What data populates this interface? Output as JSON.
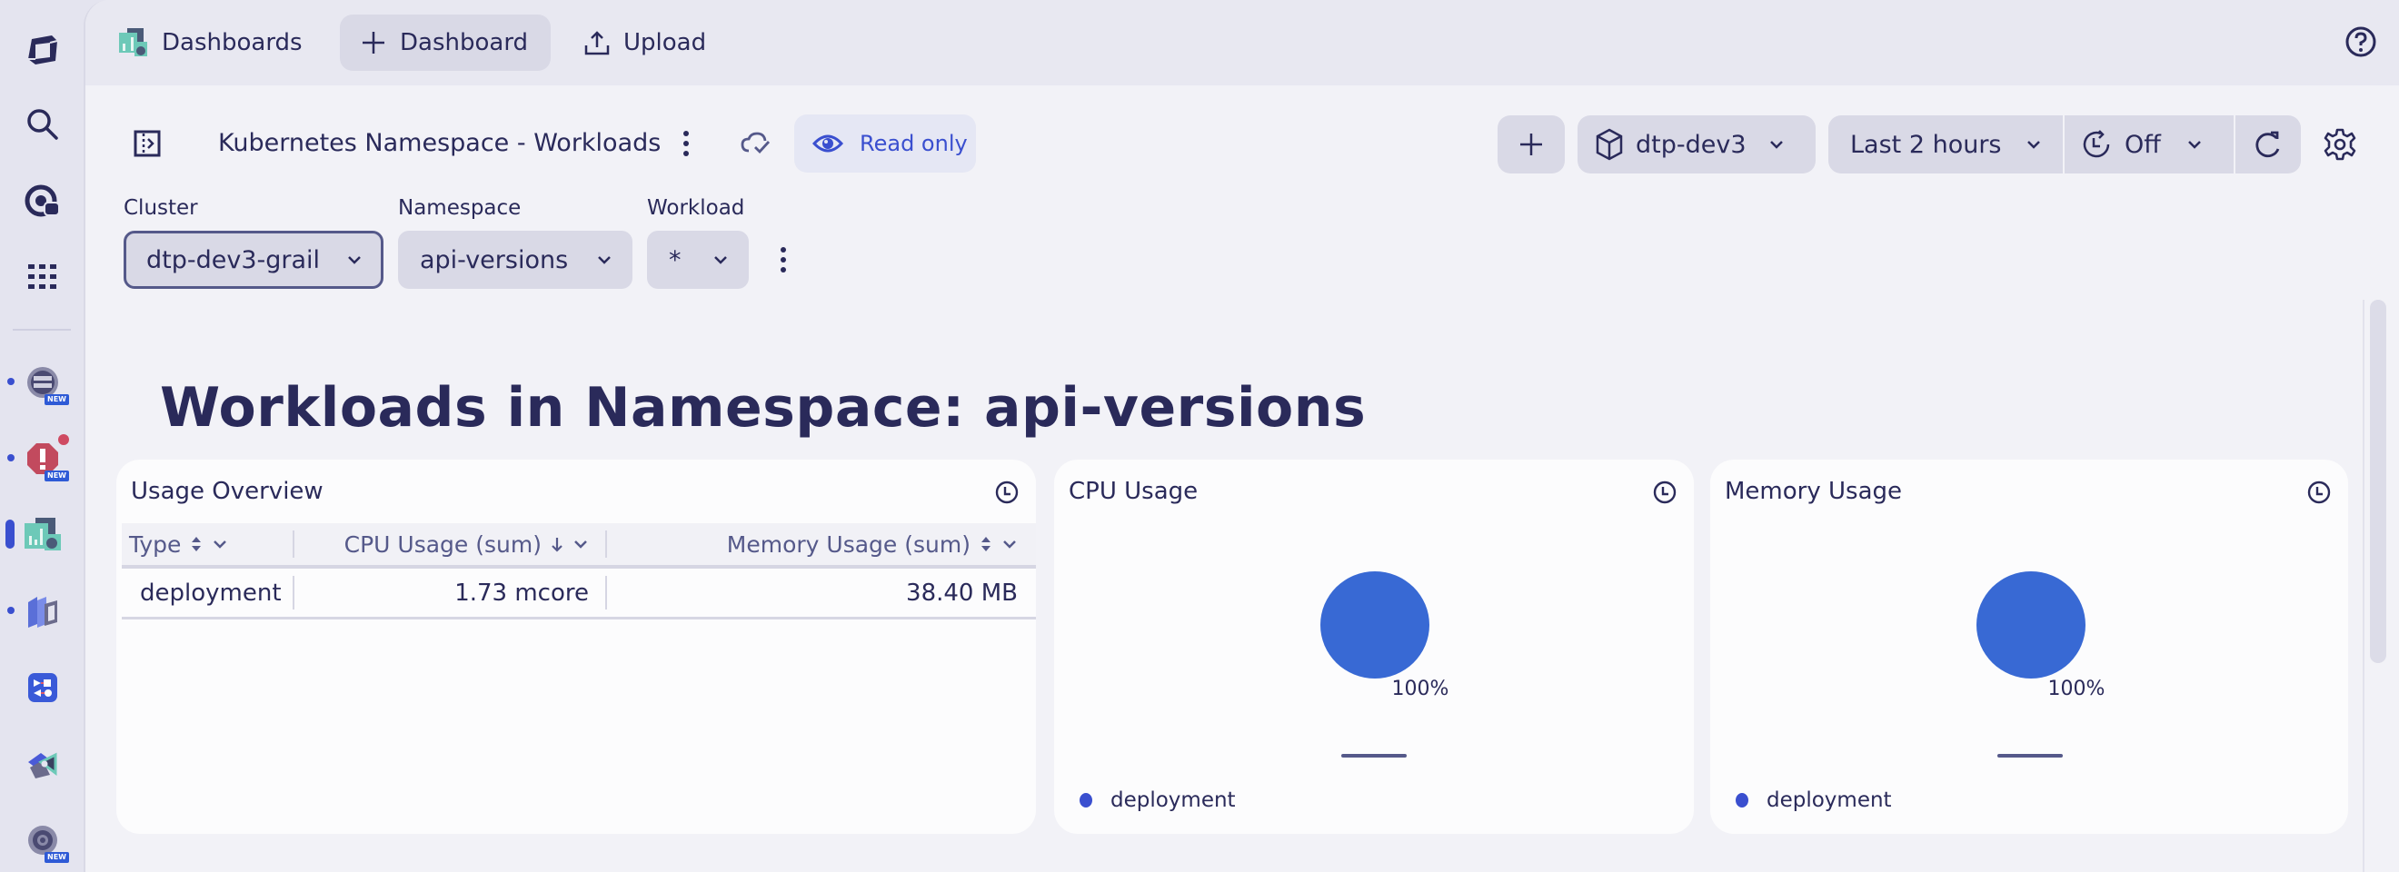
{
  "rail": {
    "items": [
      {
        "name": "dynatrace-logo",
        "active": false
      },
      {
        "name": "search",
        "active": false
      },
      {
        "name": "copilot",
        "active": false
      },
      {
        "name": "apps-grid",
        "active": false
      },
      {
        "name": "workflows-app",
        "badge": "NEW",
        "dot": true
      },
      {
        "name": "problems-app",
        "badge": "NEW",
        "dot": true,
        "alert": true
      },
      {
        "name": "dashboards-app",
        "active": true
      },
      {
        "name": "kubernetes-app",
        "dot": true
      },
      {
        "name": "automation-app"
      },
      {
        "name": "notebooks-app"
      },
      {
        "name": "settings-app",
        "badge": "NEW"
      }
    ],
    "new_badge": "NEW"
  },
  "topbar": {
    "dashboards_label": "Dashboards",
    "new_dashboard_label": "Dashboard",
    "upload_label": "Upload"
  },
  "header": {
    "title": "Kubernetes Namespace - Workloads",
    "readonly_label": "Read only",
    "environment": "dtp-dev3",
    "timeframe": "Last 2 hours",
    "refresh_interval": "Off"
  },
  "variables": [
    {
      "label": "Cluster",
      "value": "dtp-dev3-grail"
    },
    {
      "label": "Namespace",
      "value": "api-versions"
    },
    {
      "label": "Workload",
      "value": "*"
    }
  ],
  "section_title": "Workloads in Namespace: api-versions",
  "tiles": {
    "usage_overview": {
      "title": "Usage Overview",
      "columns": [
        "Type",
        "CPU Usage (sum)",
        "Memory Usage (sum)"
      ],
      "rows": [
        [
          "deployment",
          "1.73 mcore",
          "38.40 MB"
        ]
      ]
    },
    "cpu_usage": {
      "title": "CPU Usage"
    },
    "memory_usage": {
      "title": "Memory Usage"
    }
  },
  "colors": {
    "accent": "#3a4fcf",
    "pie": "#3869d4",
    "legend_dot": "#3a4fcf",
    "text": "#2a2a5a"
  },
  "chart_data": [
    {
      "type": "pie",
      "title": "CPU Usage",
      "categories": [
        "deployment"
      ],
      "values": [
        100
      ],
      "labels": [
        "100%"
      ],
      "legend": "bottom-left"
    },
    {
      "type": "pie",
      "title": "Memory Usage",
      "categories": [
        "deployment"
      ],
      "values": [
        100
      ],
      "labels": [
        "100%"
      ],
      "legend": "bottom-left"
    }
  ]
}
